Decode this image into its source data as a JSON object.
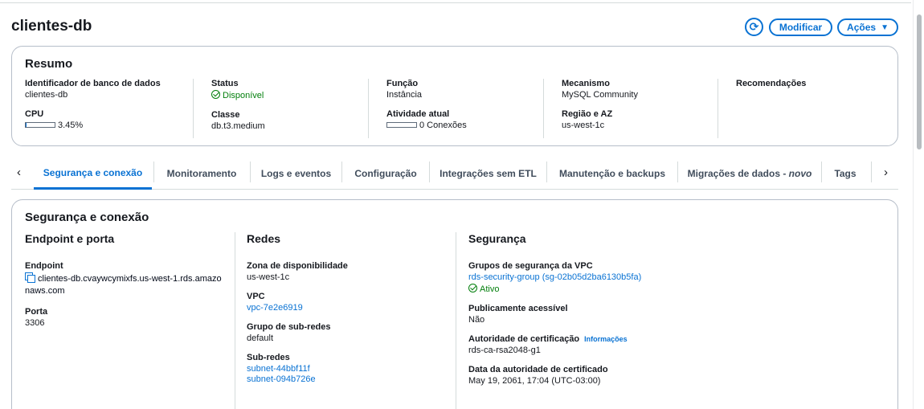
{
  "header": {
    "title": "clientes-db",
    "refresh_label": "⟳",
    "modify_label": "Modificar",
    "actions_label": "Ações",
    "actions_caret": "▼"
  },
  "summary": {
    "title": "Resumo",
    "identifier": {
      "label": "Identificador de banco de dados",
      "value": "clientes-db"
    },
    "cpu": {
      "label": "CPU",
      "value": "3.45%",
      "percent": 3.45
    },
    "status": {
      "label": "Status",
      "value": "Disponível"
    },
    "class": {
      "label": "Classe",
      "value": "db.t3.medium"
    },
    "role": {
      "label": "Função",
      "value": "Instância"
    },
    "activity": {
      "label": "Atividade atual",
      "value": "0 Conexões",
      "percent": 0
    },
    "engine": {
      "label": "Mecanismo",
      "value": "MySQL Community"
    },
    "region": {
      "label": "Região e AZ",
      "value": "us-west-1c"
    },
    "recommendations": {
      "label": "Recomendações"
    }
  },
  "tabs": {
    "prev": "‹",
    "next": "›",
    "items": [
      {
        "label": "Segurança e conexão",
        "active": true
      },
      {
        "label": "Monitoramento"
      },
      {
        "label": "Logs e eventos"
      },
      {
        "label": "Configuração"
      },
      {
        "label": "Integrações sem ETL"
      },
      {
        "label": "Manutenção e backups"
      },
      {
        "label": "Migrações de dados - ",
        "suffix": "novo"
      },
      {
        "label": "Tags"
      }
    ]
  },
  "security_connection": {
    "title": "Segurança e conexão",
    "endpoint_port": {
      "heading": "Endpoint e porta",
      "endpoint_label": "Endpoint",
      "endpoint_value": "clientes-db.cvaywcymixfs.us-west-1.rds.amazonaws.com",
      "port_label": "Porta",
      "port_value": "3306"
    },
    "networks": {
      "heading": "Redes",
      "az_label": "Zona de disponibilidade",
      "az_value": "us-west-1c",
      "vpc_label": "VPC",
      "vpc_value": "vpc-7e2e6919",
      "subnet_group_label": "Grupo de sub-redes",
      "subnet_group_value": "default",
      "subnets_label": "Sub-redes",
      "subnets": [
        "subnet-44bbf11f",
        "subnet-094b726e"
      ]
    },
    "security": {
      "heading": "Segurança",
      "vpc_sg_label": "Grupos de segurança da VPC",
      "vpc_sg_value": "rds-security-group (sg-02b05d2ba6130b5fa)",
      "vpc_sg_status": "Ativo",
      "public_label": "Publicamente acessível",
      "public_value": "Não",
      "ca_label": "Autoridade de certificação",
      "ca_info": "Informações",
      "ca_value": "rds-ca-rsa2048-g1",
      "ca_date_label": "Data da autoridade de certificado",
      "ca_date_value": "May 19, 2061, 17:04 (UTC-03:00)"
    }
  },
  "colors": {
    "accent": "#0972d3",
    "success": "#037f0c",
    "border": "#b6bec9",
    "text": "#16191f"
  }
}
